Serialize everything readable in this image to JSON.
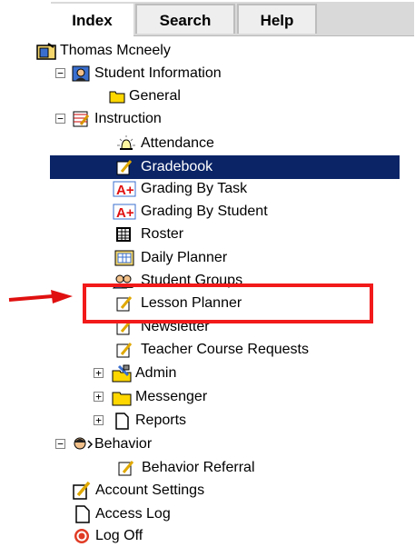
{
  "tabs": [
    {
      "label": "Index",
      "active": true
    },
    {
      "label": "Search",
      "active": false
    },
    {
      "label": "Help",
      "active": false
    }
  ],
  "tree": {
    "root": "Thomas Mcneely",
    "student_information": "Student Information",
    "general": "General",
    "instruction": "Instruction",
    "attendance": "Attendance",
    "gradebook": "Gradebook",
    "grading_by_task": "Grading By Task",
    "grading_by_student": "Grading By Student",
    "roster": "Roster",
    "daily_planner": "Daily Planner",
    "student_groups": "Student Groups",
    "lesson_planner": "Lesson Planner",
    "newsletter": "Newsletter",
    "teacher_course_requests": "Teacher Course Requests",
    "admin": "Admin",
    "messenger": "Messenger",
    "reports": "Reports",
    "behavior": "Behavior",
    "behavior_referral": "Behavior Referral",
    "account_settings": "Account Settings",
    "access_log": "Access Log",
    "log_off": "Log Off"
  },
  "expander_symbols": {
    "collapse": "−",
    "expand": "+"
  },
  "colors": {
    "selection": "#0a2466",
    "highlight_box": "#f21a1a",
    "folder": "#ffd700",
    "logoff": "#e03b24"
  }
}
